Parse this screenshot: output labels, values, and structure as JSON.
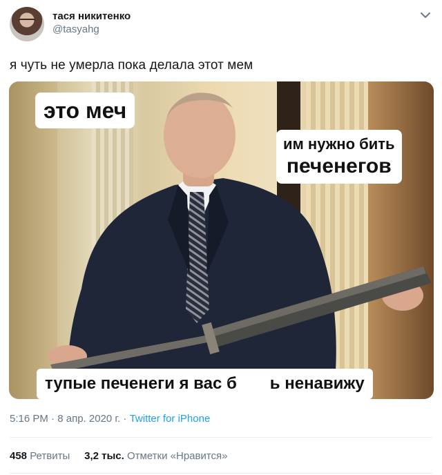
{
  "author": {
    "display_name": "тася никитенко",
    "handle": "@tasyahg"
  },
  "tweet": {
    "text": "я чуть не умерла пока делала этот мем"
  },
  "meme": {
    "caption_top_left": "это меч",
    "caption_right_line1": "им нужно бить",
    "caption_right_line2": "печенегов",
    "caption_bottom_left": "тупые печенеги я вас б",
    "caption_bottom_right": "ь ненавижу"
  },
  "meta": {
    "time": "5:16 PM",
    "date": "8 апр. 2020 г.",
    "separator": "·",
    "source": "Twitter for iPhone"
  },
  "stats": {
    "retweets_count": "458",
    "retweets_label": "Ретвиты",
    "likes_count": "3,2 тыс.",
    "likes_label": "Отметки «Нравится»"
  },
  "icons": {
    "menu": "chevron-down-icon"
  },
  "colors": {
    "link": "#1da1f2",
    "secondary_text": "#657786",
    "primary_text": "#14171a",
    "divider": "#e6ecf0"
  }
}
